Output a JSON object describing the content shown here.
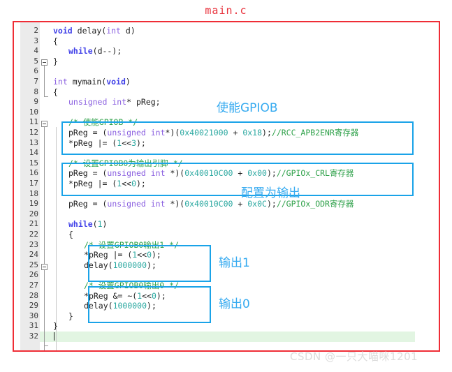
{
  "title": "main.c",
  "watermark": "CSDN @一只大喵咪1201",
  "editor": {
    "first_line": 2,
    "last_line": 32,
    "current_line": 32,
    "lines": [
      {
        "n": 2,
        "indent": 0,
        "text": "void delay(int d)"
      },
      {
        "n": 3,
        "indent": 0,
        "text": "{"
      },
      {
        "n": 4,
        "indent": 1,
        "text": "while(d--);"
      },
      {
        "n": 5,
        "indent": 0,
        "text": "}"
      },
      {
        "n": 6,
        "indent": 0,
        "text": ""
      },
      {
        "n": 7,
        "indent": 0,
        "text": "int mymain(void)"
      },
      {
        "n": 8,
        "indent": 0,
        "text": "{"
      },
      {
        "n": 9,
        "indent": 1,
        "text": "unsigned int* pReg;"
      },
      {
        "n": 10,
        "indent": 0,
        "text": ""
      },
      {
        "n": 11,
        "indent": 1,
        "text": "/* 使能GPIOB */"
      },
      {
        "n": 12,
        "indent": 1,
        "text": "pReg = (unsigned int*)(0x40021000 + 0x18);//RCC_APB2ENR寄存器"
      },
      {
        "n": 13,
        "indent": 1,
        "text": "*pReg |= (1<<3);"
      },
      {
        "n": 14,
        "indent": 0,
        "text": ""
      },
      {
        "n": 15,
        "indent": 1,
        "text": "/* 设置GPIOB0为输出引脚 */"
      },
      {
        "n": 16,
        "indent": 1,
        "text": "pReg = (unsigned int *)(0x40010C00 + 0x00);//GPIOx_CRL寄存器"
      },
      {
        "n": 17,
        "indent": 1,
        "text": "*pReg |= (1<<0);"
      },
      {
        "n": 18,
        "indent": 0,
        "text": ""
      },
      {
        "n": 19,
        "indent": 1,
        "text": "pReg = (unsigned int *)(0x40010C00 + 0x0C);//GPIOx_ODR寄存器"
      },
      {
        "n": 20,
        "indent": 0,
        "text": ""
      },
      {
        "n": 21,
        "indent": 1,
        "text": "while(1)"
      },
      {
        "n": 22,
        "indent": 1,
        "text": "{"
      },
      {
        "n": 23,
        "indent": 2,
        "text": "/* 设置GPIOB0输出1 */"
      },
      {
        "n": 24,
        "indent": 2,
        "text": "*pReg |= (1<<0);"
      },
      {
        "n": 25,
        "indent": 2,
        "text": "delay(1000000);"
      },
      {
        "n": 26,
        "indent": 0,
        "text": ""
      },
      {
        "n": 27,
        "indent": 2,
        "text": "/* 设置GPIOB0输出0 */"
      },
      {
        "n": 28,
        "indent": 2,
        "text": "*pReg &= ~(1<<0);"
      },
      {
        "n": 29,
        "indent": 2,
        "text": "delay(1000000);"
      },
      {
        "n": 30,
        "indent": 1,
        "text": "}"
      },
      {
        "n": 31,
        "indent": 0,
        "text": "}"
      },
      {
        "n": 32,
        "indent": 0,
        "text": ""
      }
    ]
  },
  "annotations": [
    {
      "label": "使能GPIOB"
    },
    {
      "label": "配置为输出"
    },
    {
      "label": "输出1"
    },
    {
      "label": "输出0"
    }
  ],
  "colors": {
    "frame": "#ef2d36",
    "title": "#e8323c",
    "highlight_box": "#1aa3e8",
    "annotation": "#35aaf0",
    "keyword": "#4040e8",
    "type": "#8a5fe0",
    "number": "#2aa8a0",
    "comment": "#2fa14a",
    "gutter_bg": "#ebebeb",
    "current_line_bg": "#e2f5e2",
    "watermark": "#dcdcdc"
  }
}
